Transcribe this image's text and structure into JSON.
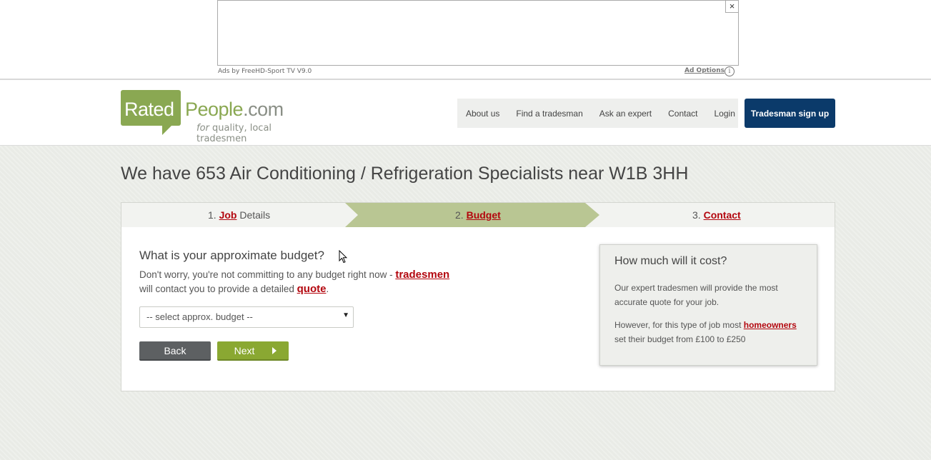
{
  "ad": {
    "close": "×",
    "by": "Ads by FreeHD-Sport TV V9.0",
    "options": "Ad Options",
    "info": "i"
  },
  "logo": {
    "rated": "Rated",
    "people": "People",
    "com": ".com",
    "tag_for": "for",
    "tag_rest": " quality, local tradesmen"
  },
  "nav": {
    "items": [
      "About us",
      "Find a tradesman",
      "Ask an expert",
      "Contact",
      "Login"
    ],
    "signup": "Tradesman sign up"
  },
  "main": {
    "title": "We have 653 Air Conditioning / Refrigeration Specialists near W1B 3HH"
  },
  "steps": {
    "s1_num": "1. ",
    "s1_link": "Job",
    "s1_rest": " Details",
    "s2_num": "2. ",
    "s2_link": "Budget",
    "s3_num": "3. ",
    "s3_link": "Contact",
    "active": 2
  },
  "budget": {
    "question": "What is your approximate budget?",
    "text_1": "Don't worry, you're not committing to any budget right now - ",
    "link_tradesmen": "tradesmen",
    "text_2": "will contact you to provide a detailed ",
    "link_quote": "quote",
    "text_3": ".",
    "select_value": "-- select approx. budget --",
    "back": "Back",
    "next": "Next"
  },
  "cost": {
    "title": "How much will it cost?",
    "p1": "Our expert tradesmen will provide the most accurate quote for your job.",
    "p2_a": "However, for this type of job most ",
    "p2_link": "homeowners",
    "p2_b": "set their budget from £100 to £250"
  },
  "colors": {
    "brand_green": "#8aa852",
    "signup_blue": "#0b3a6a",
    "link_red": "#b3060e",
    "step_active": "#b9c693"
  }
}
